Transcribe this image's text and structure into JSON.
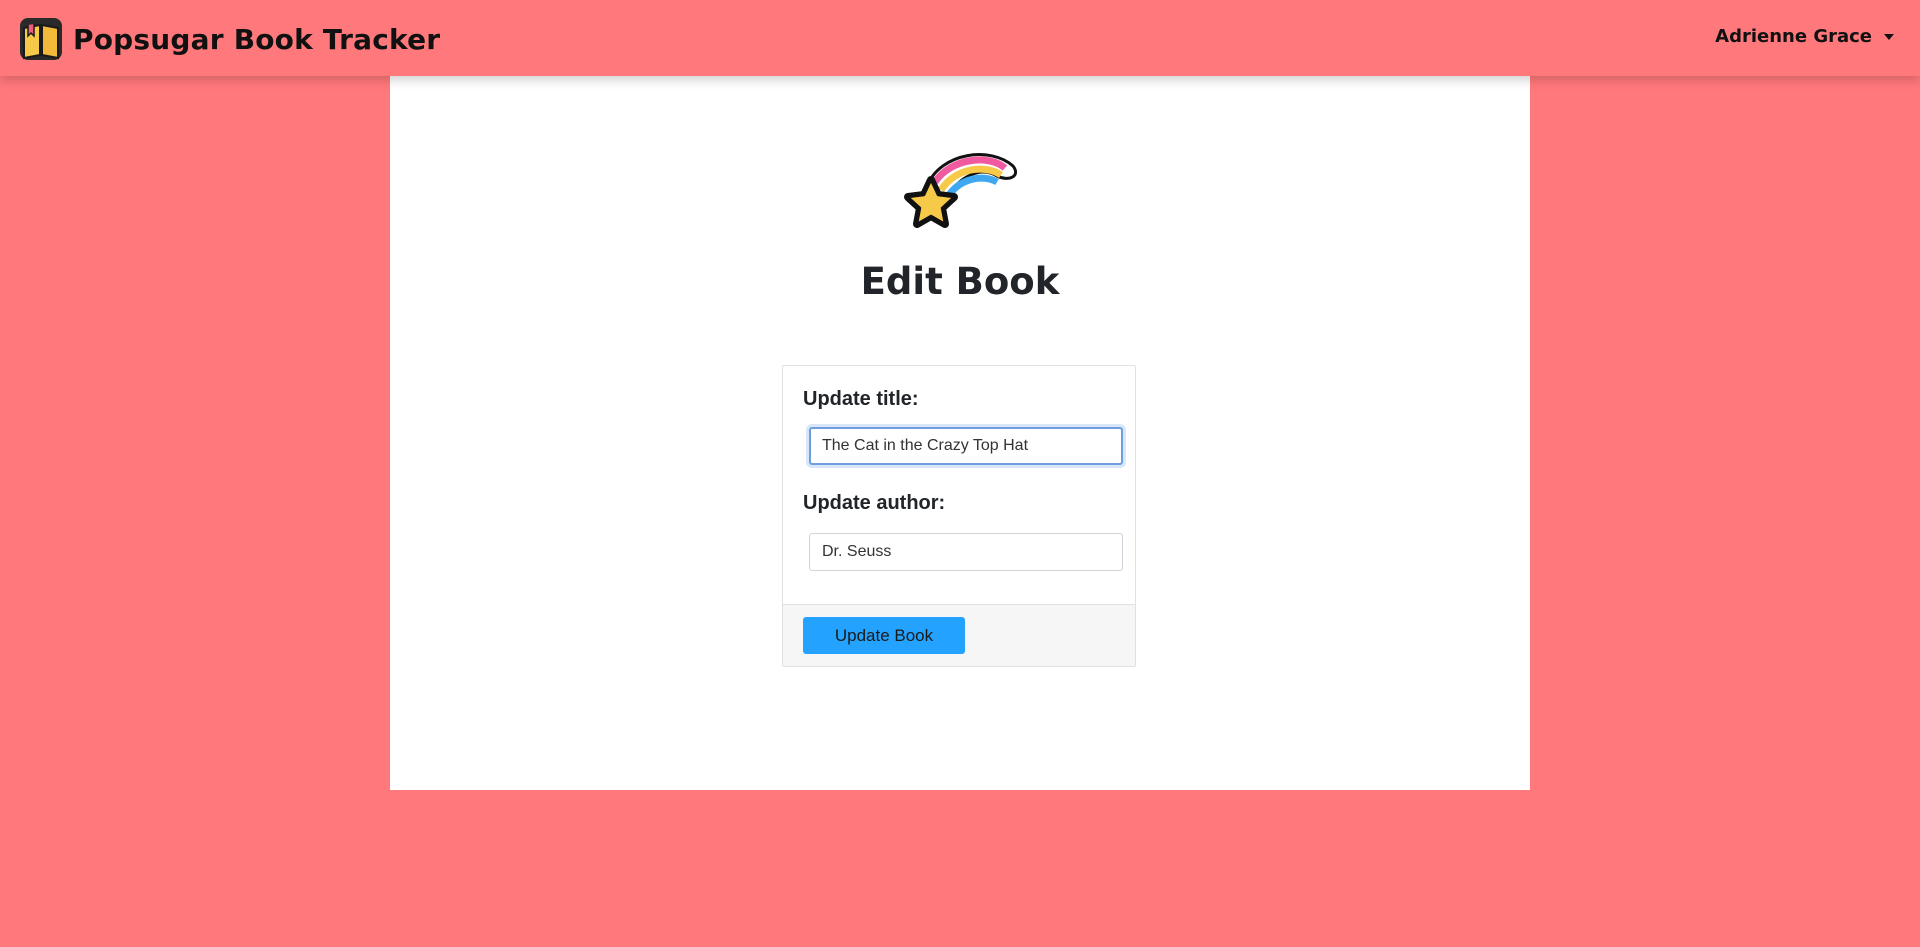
{
  "navbar": {
    "brand_icon": "open-book-icon",
    "brand_name": "Popsugar Book Tracker",
    "user_name": "Adrienne Grace",
    "user_menu_icon": "caret-down-icon"
  },
  "page": {
    "hero_icon": "shooting-star-rainbow-icon",
    "title": "Edit Book"
  },
  "form": {
    "title_label": "Update title:",
    "title_value": "The Cat in the Crazy Top Hat",
    "author_label": "Update author:",
    "author_value": "Dr. Seuss",
    "submit_label": "Update Book"
  },
  "colors": {
    "background": "#ff787b",
    "panel": "#ffffff",
    "button": "#23a3ff",
    "focus_ring": "#6f9ee0"
  }
}
